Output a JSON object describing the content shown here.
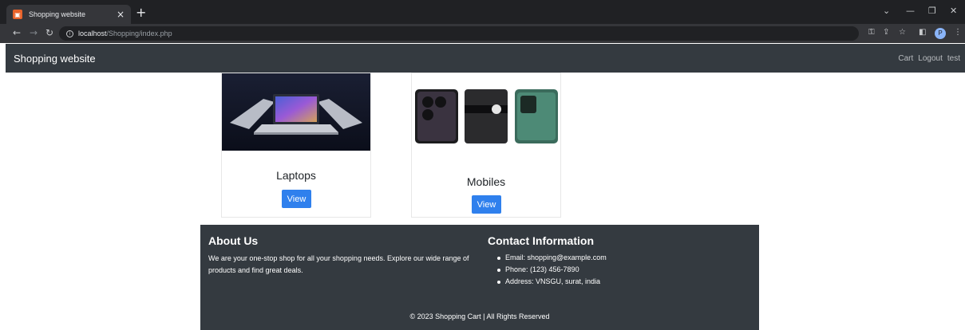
{
  "browser": {
    "tab_title": "Shopping website",
    "tab_close": "×",
    "new_tab": "+",
    "url_host": "localhost",
    "url_path": "/Shopping/index.php",
    "profile_initial": "P"
  },
  "navbar": {
    "brand": "Shopping website",
    "links": [
      "Cart",
      "Logout",
      "test"
    ]
  },
  "categories": [
    {
      "title": "Laptops",
      "button_label": "View"
    },
    {
      "title": "Mobiles",
      "button_label": "View"
    }
  ],
  "footer": {
    "about_heading": "About Us",
    "about_text": "We are your one-stop shop for all your shopping needs. Explore our wide range of products and find great deals.",
    "contact_heading": "Contact Information",
    "contact_items": [
      "Email: shopping@example.com",
      "Phone: (123) 456-7890",
      "Address: VNSGU, surat, india"
    ],
    "copyright": "© 2023 Shopping Cart | All Rights Reserved"
  },
  "colors": {
    "navbar_bg": "#343a40",
    "button_bg": "#2f80ed",
    "browser_dark": "#202124"
  },
  "icons": [
    "back-icon",
    "forward-icon",
    "reload-icon",
    "info-icon",
    "key-icon",
    "share-icon",
    "star-icon",
    "sidepanel-icon",
    "menu-icon"
  ]
}
